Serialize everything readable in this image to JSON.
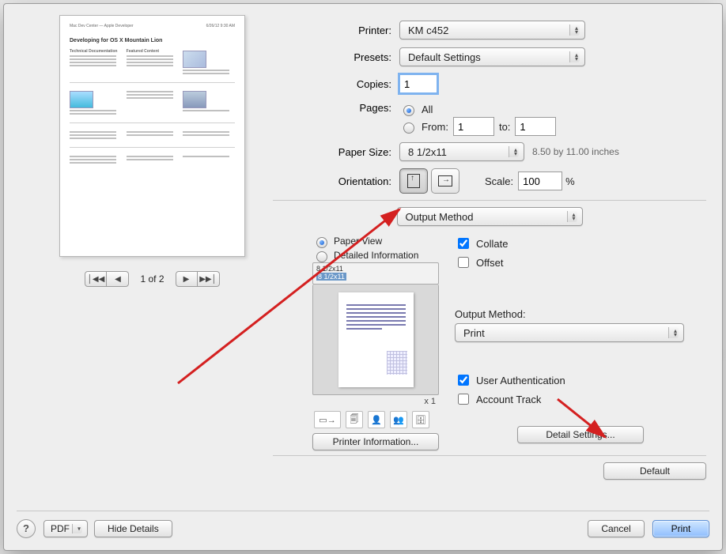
{
  "preview": {
    "thumb_title": "Developing for OS X Mountain Lion",
    "page_indicator": "1 of 2"
  },
  "labels": {
    "printer": "Printer:",
    "presets": "Presets:",
    "copies": "Copies:",
    "pages": "Pages:",
    "all": "All",
    "from": "From:",
    "to": "to:",
    "paper_size": "Paper Size:",
    "orientation": "Orientation:",
    "scale": "Scale:",
    "percent": "%"
  },
  "values": {
    "printer": "KM c452",
    "presets": "Default Settings",
    "copies": "1",
    "pages_mode": "all",
    "from": "1",
    "to": "1",
    "paper_size": "8 1/2x11",
    "paper_hint": "8.50 by 11.00 inches",
    "scale": "100"
  },
  "options_section": {
    "combo_label": "Output Method",
    "view_mode": {
      "paper_view": "Paper View",
      "detailed": "Detailed Information"
    },
    "mini_list_a": "8 1/2x11",
    "mini_list_b": "8 1/2x11",
    "count": "x 1",
    "collate": "Collate",
    "offset": "Offset",
    "output_method_label": "Output Method:",
    "output_method_value": "Print",
    "user_auth": "User Authentication",
    "account_track": "Account Track",
    "detail_settings": "Detail Settings...",
    "printer_info": "Printer Information...",
    "default": "Default"
  },
  "bottom": {
    "pdf": "PDF",
    "hide_details": "Hide Details",
    "cancel": "Cancel",
    "print": "Print",
    "help": "?"
  }
}
